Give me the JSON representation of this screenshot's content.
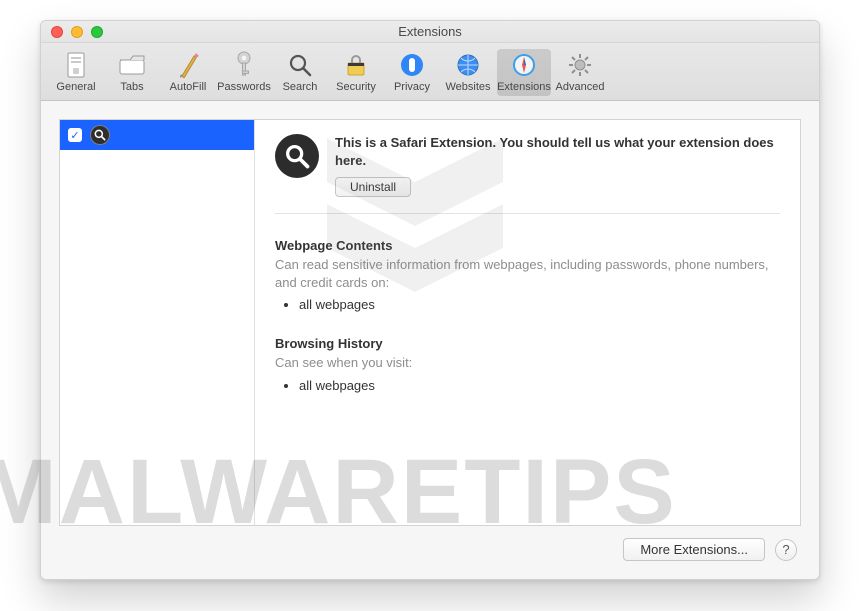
{
  "window": {
    "title": "Extensions"
  },
  "toolbar": {
    "items": [
      {
        "label": "General"
      },
      {
        "label": "Tabs"
      },
      {
        "label": "AutoFill"
      },
      {
        "label": "Passwords"
      },
      {
        "label": "Search"
      },
      {
        "label": "Security"
      },
      {
        "label": "Privacy"
      },
      {
        "label": "Websites"
      },
      {
        "label": "Extensions"
      },
      {
        "label": "Advanced"
      }
    ],
    "selected_index": 8
  },
  "sidebar": {
    "items": [
      {
        "checked": true
      }
    ]
  },
  "detail": {
    "description": "This is a Safari Extension. You should tell us what your extension does here.",
    "uninstall_label": "Uninstall",
    "permissions": [
      {
        "title": "Webpage Contents",
        "desc": "Can read sensitive information from webpages, including passwords, phone numbers, and credit cards on:",
        "items": [
          "all webpages"
        ]
      },
      {
        "title": "Browsing History",
        "desc": "Can see when you visit:",
        "items": [
          "all webpages"
        ]
      }
    ]
  },
  "footer": {
    "more_label": "More Extensions...",
    "help_label": "?"
  },
  "watermark": "MALWARETIPS"
}
